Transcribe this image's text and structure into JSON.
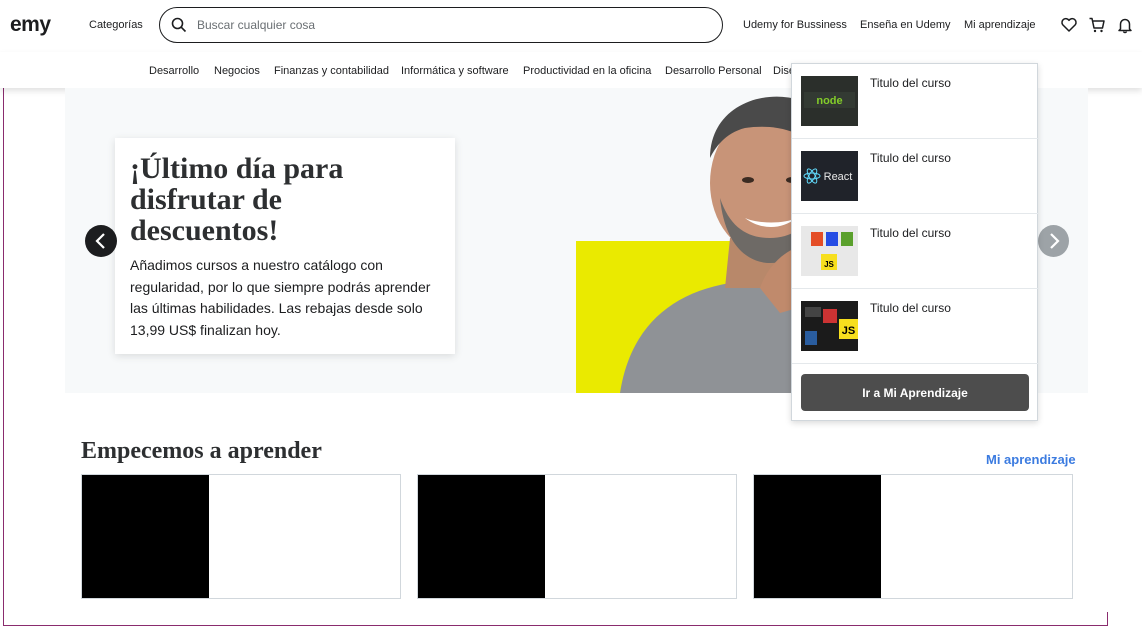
{
  "header": {
    "logo": "emy",
    "categories": "Categorías",
    "search_placeholder": "Buscar cualquier cosa",
    "business": "Udemy for Bussiness",
    "teach": "Enseña en Udemy",
    "my_learning": "Mi aprendizaje",
    "icons": [
      "heart-icon",
      "cart-icon",
      "bell-icon"
    ]
  },
  "nav": {
    "items": [
      "Desarrollo",
      "Negocios",
      "Finanzas y contabilidad",
      "Informática y software",
      "Productividad en la oficina",
      "Desarrollo Personal",
      "Dise"
    ]
  },
  "hero": {
    "title": "¡Último día para disfrutar de descuentos!",
    "text": "Añadimos cursos a nuestro catálogo con regularidad, por lo que siempre podrás aprender las últimas habilidades. Las rebajas desde solo 13,99 US$ finalizan hoy."
  },
  "dropdown": {
    "items": [
      {
        "title": "Titulo del curso",
        "thumb": "node"
      },
      {
        "title": "Titulo del curso",
        "thumb": "React"
      },
      {
        "title": "Titulo del curso",
        "thumb": "html-css-js"
      },
      {
        "title": "Titulo del curso",
        "thumb": "js"
      }
    ],
    "button": "Ir a Mi Aprendizaje"
  },
  "learn": {
    "title": "Empecemos a aprender",
    "link": "Mi aprendizaje"
  },
  "colors": {
    "accent_link": "#3b7be0",
    "hero_yellow": "#eaea00",
    "dark_button": "#4d4d4d",
    "frame": "#8a2c6e"
  }
}
